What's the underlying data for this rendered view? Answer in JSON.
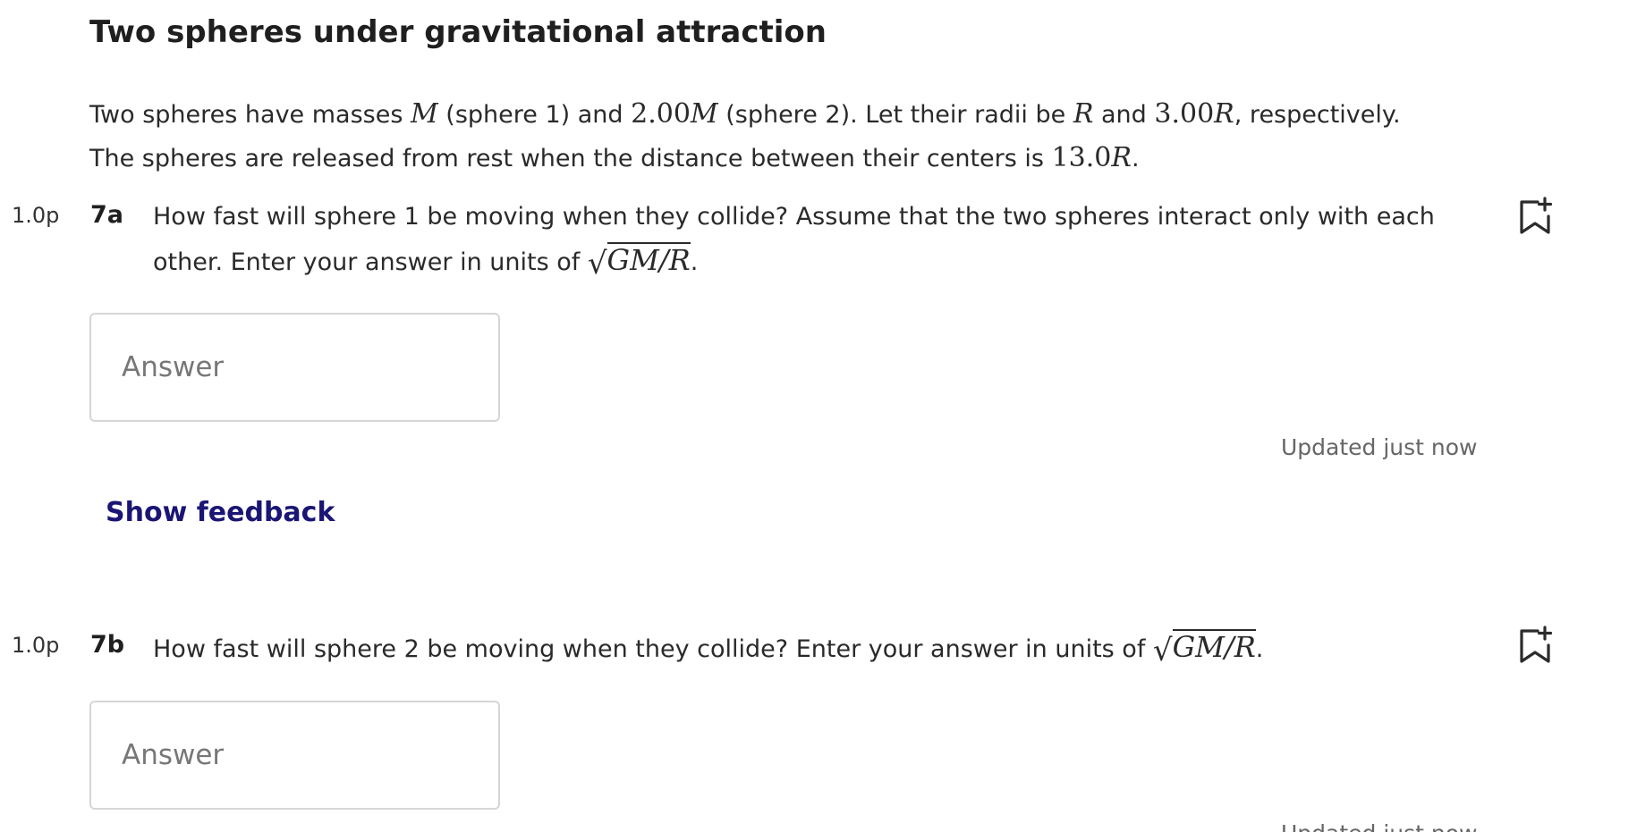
{
  "title": "Two spheres under gravitational attraction",
  "intro": {
    "l1_a": "Two spheres have masses ",
    "l1_m1": "M",
    "l1_b": " (sphere 1) and ",
    "l1_m2": "2.00",
    "l1_m2v": "M",
    "l1_c": " (sphere 2). Let their radii be ",
    "l1_r1": "R",
    "l1_d": " and ",
    "l1_r2": "3.00",
    "l1_r2v": "R",
    "l1_e": ", respectively.",
    "l2_a": "The spheres are released from rest when the distance between their centers is ",
    "l2_d": "13.0",
    "l2_dv": "R",
    "l2_b": "."
  },
  "questions": [
    {
      "points": "1.0p",
      "number": "7a",
      "line1": "How fast will sphere 1 be moving when they collide? Assume that the two spheres interact only with each",
      "line2": "other. Enter your answer in units of ",
      "sqrt": "GM/R",
      "end": ".",
      "placeholder": "Answer",
      "updated": "Updated just now",
      "feedback": "Show feedback"
    },
    {
      "points": "1.0p",
      "number": "7b",
      "line1": "How fast will sphere 2 be moving when they collide? Enter your answer in units of ",
      "sqrt": "GM/R",
      "end": ".",
      "placeholder": "Answer",
      "updated": "Updated just now"
    }
  ],
  "icons": {
    "bookmark": "bookmark-add-icon"
  }
}
